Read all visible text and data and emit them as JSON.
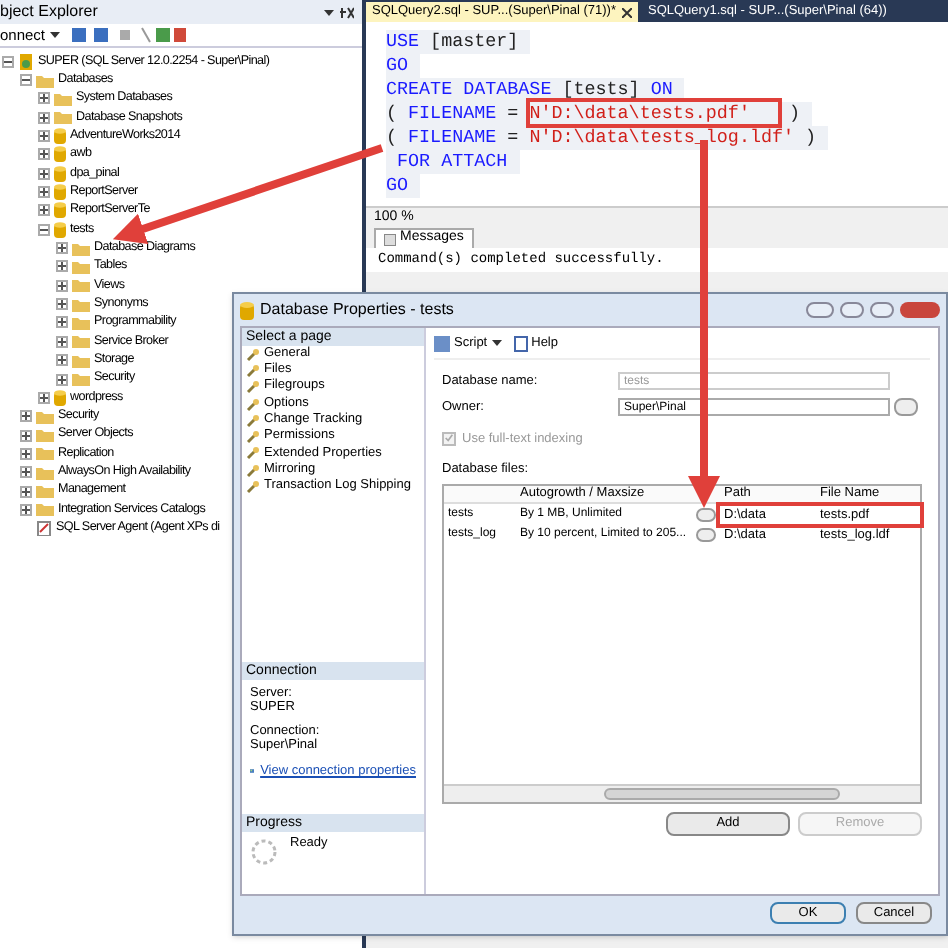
{
  "object_explorer": {
    "title": "bject Explorer",
    "toolbar_label": "onnect",
    "tree": [
      {
        "label": "SUPER (SQL Server 12.0.2254 - Super\\Pinal)",
        "kind": "server",
        "expanded": true,
        "children": [
          {
            "label": "Databases",
            "kind": "folder",
            "expanded": true,
            "children": [
              {
                "label": "System Databases",
                "kind": "folder",
                "expanded": false
              },
              {
                "label": "Database Snapshots",
                "kind": "folder",
                "expanded": false
              },
              {
                "label": "AdventureWorks2014",
                "kind": "database",
                "expanded": false
              },
              {
                "label": "awb",
                "kind": "database",
                "expanded": false
              },
              {
                "label": "dpa_pinal",
                "kind": "database",
                "expanded": false
              },
              {
                "label": "ReportServer",
                "kind": "database",
                "expanded": false
              },
              {
                "label": "ReportServerTe",
                "kind": "database",
                "expanded": false
              },
              {
                "label": "tests",
                "kind": "database",
                "expanded": true,
                "children": [
                  {
                    "label": "Database Diagrams",
                    "kind": "folder",
                    "expanded": false
                  },
                  {
                    "label": "Tables",
                    "kind": "folder",
                    "expanded": false
                  },
                  {
                    "label": "Views",
                    "kind": "folder",
                    "expanded": false
                  },
                  {
                    "label": "Synonyms",
                    "kind": "folder",
                    "expanded": false
                  },
                  {
                    "label": "Programmability",
                    "kind": "folder",
                    "expanded": false
                  },
                  {
                    "label": "Service Broker",
                    "kind": "folder",
                    "expanded": false
                  },
                  {
                    "label": "Storage",
                    "kind": "folder",
                    "expanded": false
                  },
                  {
                    "label": "Security",
                    "kind": "folder",
                    "expanded": false
                  }
                ]
              },
              {
                "label": "wordpress",
                "kind": "database",
                "expanded": false
              }
            ]
          },
          {
            "label": "Security",
            "kind": "folder",
            "expanded": false
          },
          {
            "label": "Server Objects",
            "kind": "folder",
            "expanded": false
          },
          {
            "label": "Replication",
            "kind": "folder",
            "expanded": false
          },
          {
            "label": "AlwaysOn High Availability",
            "kind": "folder",
            "expanded": false
          },
          {
            "label": "Management",
            "kind": "folder",
            "expanded": false
          },
          {
            "label": "Integration Services Catalogs",
            "kind": "folder",
            "expanded": false
          },
          {
            "label": "SQL Server Agent (Agent XPs di",
            "kind": "agent"
          }
        ]
      }
    ]
  },
  "editor": {
    "tabs": [
      {
        "label": "SQLQuery2.sql - SUP...(Super\\Pinal (71))*",
        "selected": true
      },
      {
        "label": "SQLQuery1.sql - SUP...(Super\\Pinal (64))",
        "selected": false
      }
    ],
    "code": [
      [
        {
          "text": "USE",
          "kind": "keyword"
        },
        {
          "text": " [master]",
          "kind": "plain"
        }
      ],
      [
        {
          "text": "GO",
          "kind": "keyword"
        }
      ],
      [
        {
          "text": "CREATE DATABASE",
          "kind": "keyword"
        },
        {
          "text": " [tests] ",
          "kind": "plain"
        },
        {
          "text": "ON",
          "kind": "keyword"
        }
      ],
      [
        {
          "text": "( ",
          "kind": "plain"
        },
        {
          "text": "FILENAME",
          "kind": "keyword"
        },
        {
          "text": " = ",
          "kind": "plain"
        },
        {
          "text": "N'D:\\data\\tests.pdf'",
          "kind": "string",
          "boxed": true
        },
        {
          "text": " )",
          "kind": "plain"
        }
      ],
      [
        {
          "text": "( ",
          "kind": "plain"
        },
        {
          "text": "FILENAME",
          "kind": "keyword"
        },
        {
          "text": " = ",
          "kind": "plain"
        },
        {
          "text": "N'D:\\data\\tests_log.ldf'",
          "kind": "string"
        },
        {
          "text": " )",
          "kind": "plain"
        }
      ],
      [
        {
          "text": " FOR ATTACH",
          "kind": "keyword"
        }
      ],
      [
        {
          "text": "GO",
          "kind": "keyword"
        }
      ]
    ],
    "zoom": "100 %",
    "results_tab": "Messages",
    "message": "Command(s) completed successfully."
  },
  "dialog": {
    "title": "Database Properties - tests",
    "pages_header": "Select a page",
    "pages": [
      "General",
      "Files",
      "Filegroups",
      "Options",
      "Change Tracking",
      "Permissions",
      "Extended Properties",
      "Mirroring",
      "Transaction Log Shipping"
    ],
    "connection_header": "Connection",
    "server_label": "Server:",
    "server": "SUPER",
    "connection_label": "Connection:",
    "connection": "Super\\Pinal",
    "connection_link": "View connection properties",
    "progress_header": "Progress",
    "progress_status": "Ready",
    "toolbar": [
      "Script",
      "Help"
    ],
    "database_name_label": "Database name:",
    "database_name": "tests",
    "owner_label": "Owner:",
    "owner": "Super\\Pinal",
    "fulltext": {
      "label": "Use full-text indexing",
      "checked": true,
      "disabled": true
    },
    "files_label": "Database files:",
    "columns": [
      "Autogrowth / Maxsize",
      "Path",
      "File Name"
    ],
    "rows": [
      {
        "name": "tests",
        "autogrowth": "By 1 MB, Unlimited",
        "path": "D:\\data",
        "file_name": "tests.pdf",
        "boxed": true
      },
      {
        "name": "tests_log",
        "autogrowth": "By 10 percent, Limited to 205...",
        "path": "D:\\data",
        "file_name": "tests_log.ldf",
        "boxed": false
      }
    ],
    "buttons": [
      {
        "label": "Add",
        "disabled": false
      },
      {
        "label": "Remove",
        "disabled": true
      }
    ],
    "footer_buttons": [
      "OK",
      "Cancel"
    ]
  }
}
